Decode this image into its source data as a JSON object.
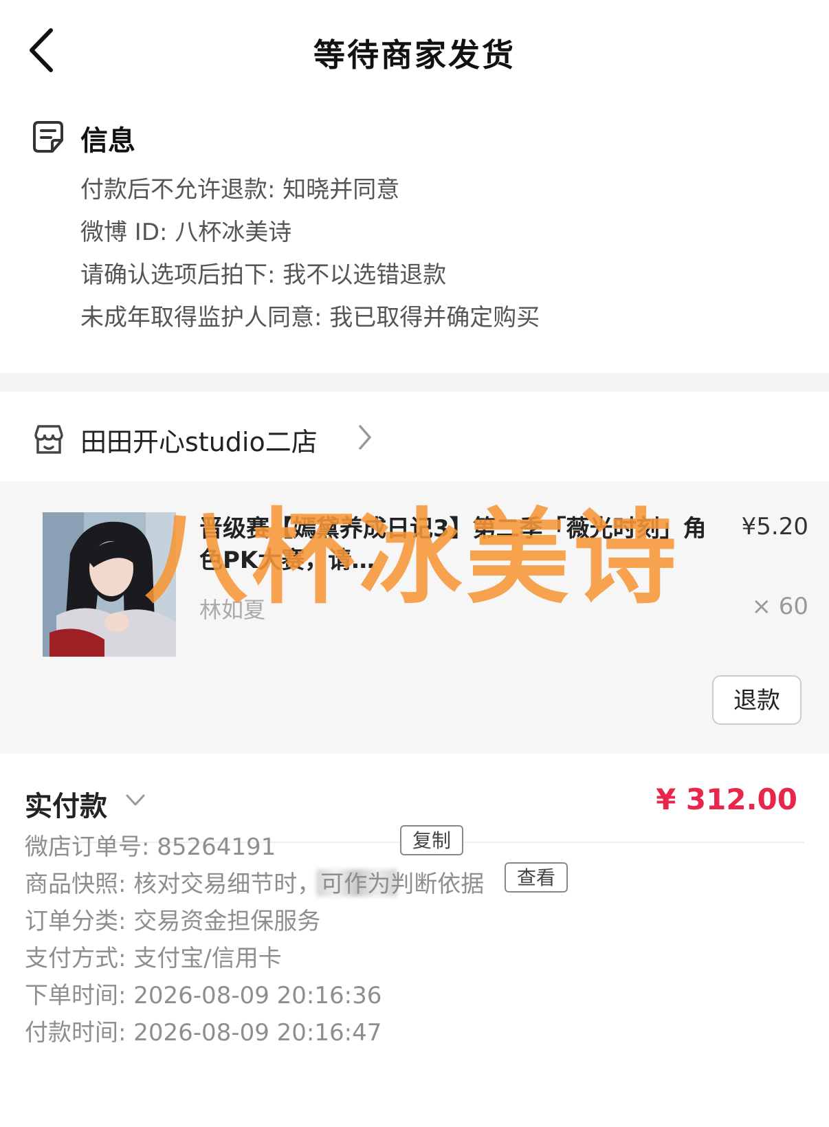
{
  "header": {
    "title": "等待商家发货",
    "back_icon": "chevron-left-icon"
  },
  "info": {
    "heading": "信息",
    "icon": "note-icon",
    "lines": [
      "付款后不允许退款: 知晓并同意",
      "微博 ID: 八杯冰美诗",
      "请确认选项后拍下: 我不以选错退款",
      "未成年取得监护人同意: 我已取得并确定购买"
    ]
  },
  "shop": {
    "name": "田田开心studio二店",
    "icon": "store-icon"
  },
  "item": {
    "title": "晋级赛【嫣黛养成日记3】第二季「薇光时刻」角色PK大赛，请…",
    "price": "¥5.20",
    "sku": "林如夏",
    "quantity": "× 60",
    "refund_label": "退款"
  },
  "watermark": "八杯冰美诗",
  "payment": {
    "label": "实付款",
    "amount": "¥ 312.00",
    "amount_color": "#e8264c"
  },
  "details": {
    "order_no": "微店订单号:  85264191",
    "copy_label": "复制",
    "snapshot": "商品快照: 核对交易细节时，可作为判断依据",
    "view_label": "查看",
    "category": "订单分类:  交易资金担保服务",
    "pay_method": "支付方式:  支付宝/信用卡",
    "order_time": "下单时间:  2026-08-09 20:16:36",
    "pay_time": "付款时间:  2026-08-09 20:16:47"
  }
}
